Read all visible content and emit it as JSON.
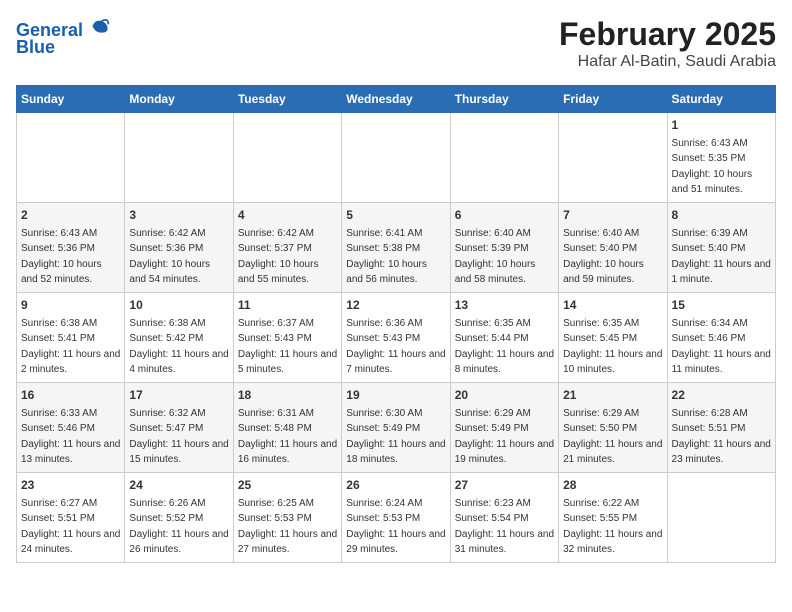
{
  "header": {
    "logo_line1": "General",
    "logo_line2": "Blue",
    "title": "February 2025",
    "subtitle": "Hafar Al-Batin, Saudi Arabia"
  },
  "weekdays": [
    "Sunday",
    "Monday",
    "Tuesday",
    "Wednesday",
    "Thursday",
    "Friday",
    "Saturday"
  ],
  "weeks": [
    [
      {
        "day": "",
        "info": ""
      },
      {
        "day": "",
        "info": ""
      },
      {
        "day": "",
        "info": ""
      },
      {
        "day": "",
        "info": ""
      },
      {
        "day": "",
        "info": ""
      },
      {
        "day": "",
        "info": ""
      },
      {
        "day": "1",
        "info": "Sunrise: 6:43 AM\nSunset: 5:35 PM\nDaylight: 10 hours and 51 minutes."
      }
    ],
    [
      {
        "day": "2",
        "info": "Sunrise: 6:43 AM\nSunset: 5:36 PM\nDaylight: 10 hours and 52 minutes."
      },
      {
        "day": "3",
        "info": "Sunrise: 6:42 AM\nSunset: 5:36 PM\nDaylight: 10 hours and 54 minutes."
      },
      {
        "day": "4",
        "info": "Sunrise: 6:42 AM\nSunset: 5:37 PM\nDaylight: 10 hours and 55 minutes."
      },
      {
        "day": "5",
        "info": "Sunrise: 6:41 AM\nSunset: 5:38 PM\nDaylight: 10 hours and 56 minutes."
      },
      {
        "day": "6",
        "info": "Sunrise: 6:40 AM\nSunset: 5:39 PM\nDaylight: 10 hours and 58 minutes."
      },
      {
        "day": "7",
        "info": "Sunrise: 6:40 AM\nSunset: 5:40 PM\nDaylight: 10 hours and 59 minutes."
      },
      {
        "day": "8",
        "info": "Sunrise: 6:39 AM\nSunset: 5:40 PM\nDaylight: 11 hours and 1 minute."
      }
    ],
    [
      {
        "day": "9",
        "info": "Sunrise: 6:38 AM\nSunset: 5:41 PM\nDaylight: 11 hours and 2 minutes."
      },
      {
        "day": "10",
        "info": "Sunrise: 6:38 AM\nSunset: 5:42 PM\nDaylight: 11 hours and 4 minutes."
      },
      {
        "day": "11",
        "info": "Sunrise: 6:37 AM\nSunset: 5:43 PM\nDaylight: 11 hours and 5 minutes."
      },
      {
        "day": "12",
        "info": "Sunrise: 6:36 AM\nSunset: 5:43 PM\nDaylight: 11 hours and 7 minutes."
      },
      {
        "day": "13",
        "info": "Sunrise: 6:35 AM\nSunset: 5:44 PM\nDaylight: 11 hours and 8 minutes."
      },
      {
        "day": "14",
        "info": "Sunrise: 6:35 AM\nSunset: 5:45 PM\nDaylight: 11 hours and 10 minutes."
      },
      {
        "day": "15",
        "info": "Sunrise: 6:34 AM\nSunset: 5:46 PM\nDaylight: 11 hours and 11 minutes."
      }
    ],
    [
      {
        "day": "16",
        "info": "Sunrise: 6:33 AM\nSunset: 5:46 PM\nDaylight: 11 hours and 13 minutes."
      },
      {
        "day": "17",
        "info": "Sunrise: 6:32 AM\nSunset: 5:47 PM\nDaylight: 11 hours and 15 minutes."
      },
      {
        "day": "18",
        "info": "Sunrise: 6:31 AM\nSunset: 5:48 PM\nDaylight: 11 hours and 16 minutes."
      },
      {
        "day": "19",
        "info": "Sunrise: 6:30 AM\nSunset: 5:49 PM\nDaylight: 11 hours and 18 minutes."
      },
      {
        "day": "20",
        "info": "Sunrise: 6:29 AM\nSunset: 5:49 PM\nDaylight: 11 hours and 19 minutes."
      },
      {
        "day": "21",
        "info": "Sunrise: 6:29 AM\nSunset: 5:50 PM\nDaylight: 11 hours and 21 minutes."
      },
      {
        "day": "22",
        "info": "Sunrise: 6:28 AM\nSunset: 5:51 PM\nDaylight: 11 hours and 23 minutes."
      }
    ],
    [
      {
        "day": "23",
        "info": "Sunrise: 6:27 AM\nSunset: 5:51 PM\nDaylight: 11 hours and 24 minutes."
      },
      {
        "day": "24",
        "info": "Sunrise: 6:26 AM\nSunset: 5:52 PM\nDaylight: 11 hours and 26 minutes."
      },
      {
        "day": "25",
        "info": "Sunrise: 6:25 AM\nSunset: 5:53 PM\nDaylight: 11 hours and 27 minutes."
      },
      {
        "day": "26",
        "info": "Sunrise: 6:24 AM\nSunset: 5:53 PM\nDaylight: 11 hours and 29 minutes."
      },
      {
        "day": "27",
        "info": "Sunrise: 6:23 AM\nSunset: 5:54 PM\nDaylight: 11 hours and 31 minutes."
      },
      {
        "day": "28",
        "info": "Sunrise: 6:22 AM\nSunset: 5:55 PM\nDaylight: 11 hours and 32 minutes."
      },
      {
        "day": "",
        "info": ""
      }
    ]
  ]
}
